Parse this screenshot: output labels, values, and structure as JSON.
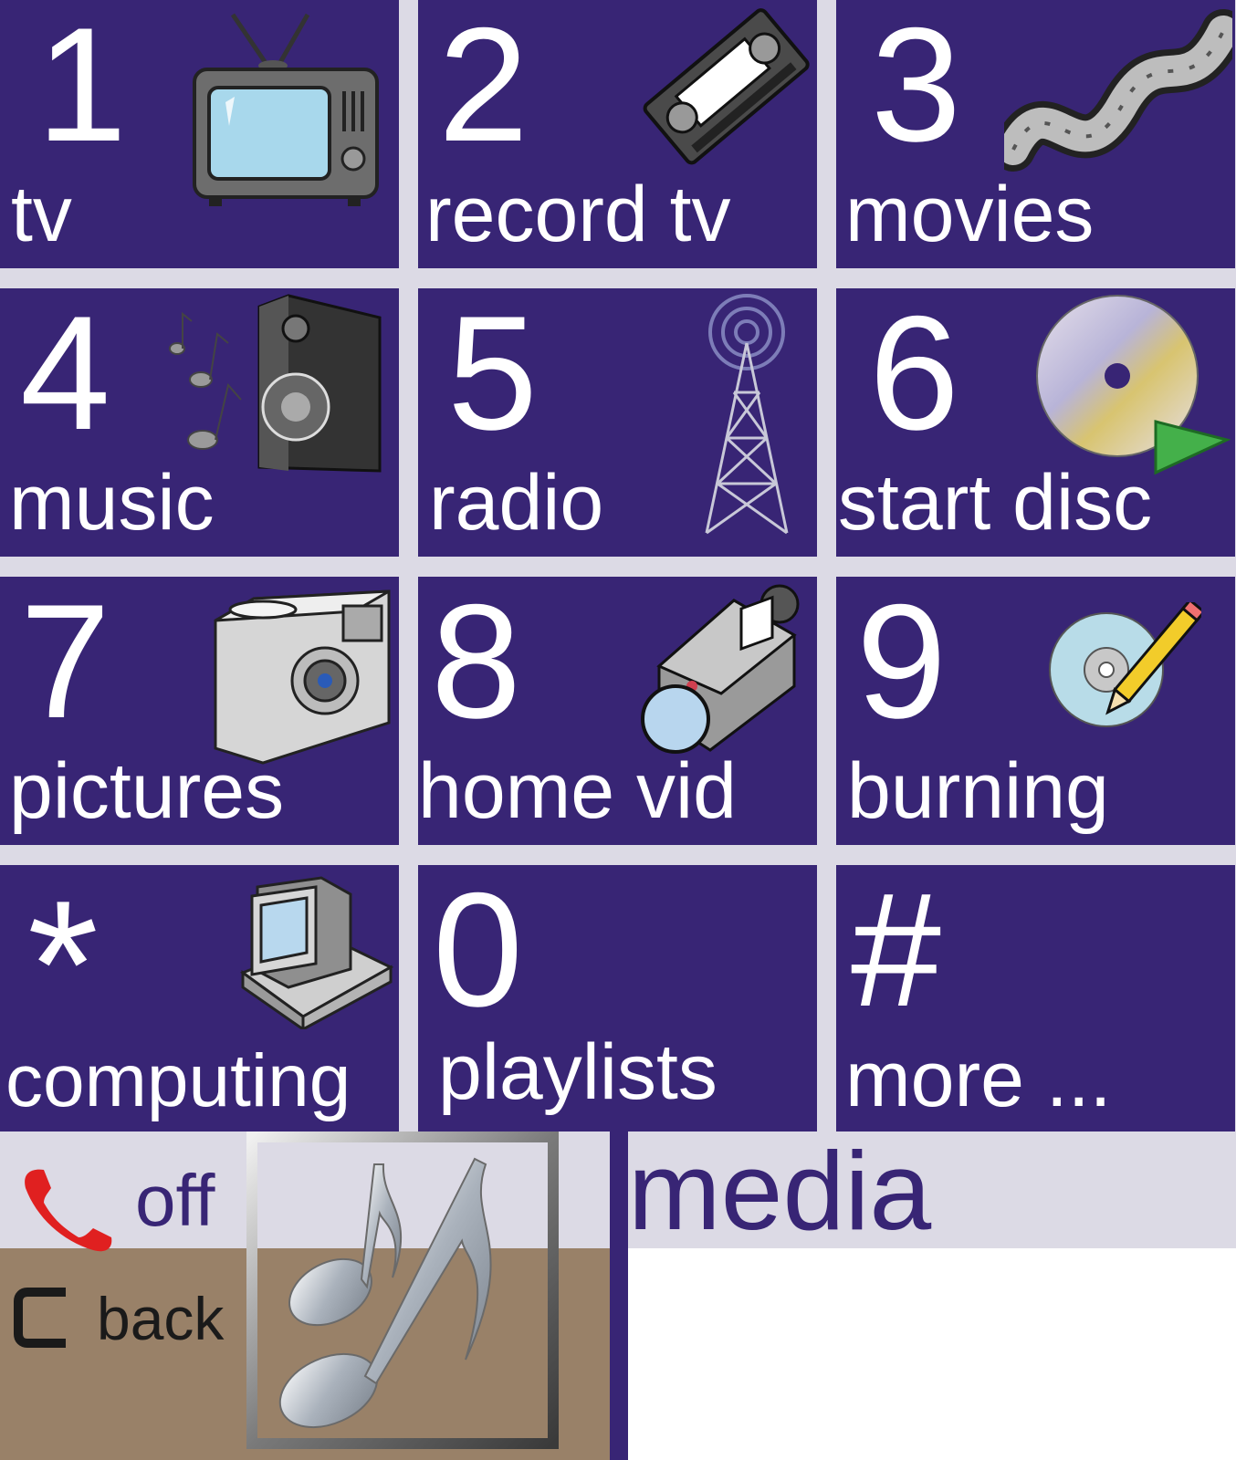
{
  "keypad": {
    "tiles": [
      {
        "key": "1",
        "label": "tv",
        "icon": "tv-icon"
      },
      {
        "key": "2",
        "label": "record tv",
        "icon": "video-cassette-icon"
      },
      {
        "key": "3",
        "label": "movies",
        "icon": "film-strip-icon"
      },
      {
        "key": "4",
        "label": "music",
        "icon": "speaker-music-icon"
      },
      {
        "key": "5",
        "label": "radio",
        "icon": "radio-tower-icon"
      },
      {
        "key": "6",
        "label": "start disc",
        "icon": "disc-play-icon"
      },
      {
        "key": "7",
        "label": "pictures",
        "icon": "camera-icon"
      },
      {
        "key": "8",
        "label": "home vid",
        "icon": "video-camera-icon"
      },
      {
        "key": "9",
        "label": "burning",
        "icon": "disc-pencil-icon"
      },
      {
        "key": "*",
        "label": "computing",
        "icon": "computer-icon"
      },
      {
        "key": "0",
        "label": "playlists",
        "icon": ""
      },
      {
        "key": "#",
        "label": "more ...",
        "icon": ""
      }
    ]
  },
  "footer": {
    "off_label": "off",
    "off_icon": "phone-hangup-icon",
    "back_label": "back",
    "back_icon": "c-key-icon",
    "logo_icon": "music-notes-icon",
    "title": "media"
  },
  "colors": {
    "tile_bg": "#382575",
    "panel_bg": "#dcdae5",
    "back_panel_bg": "#998168",
    "text_on_tile": "#ffffff",
    "hangup_red": "#e02020"
  }
}
